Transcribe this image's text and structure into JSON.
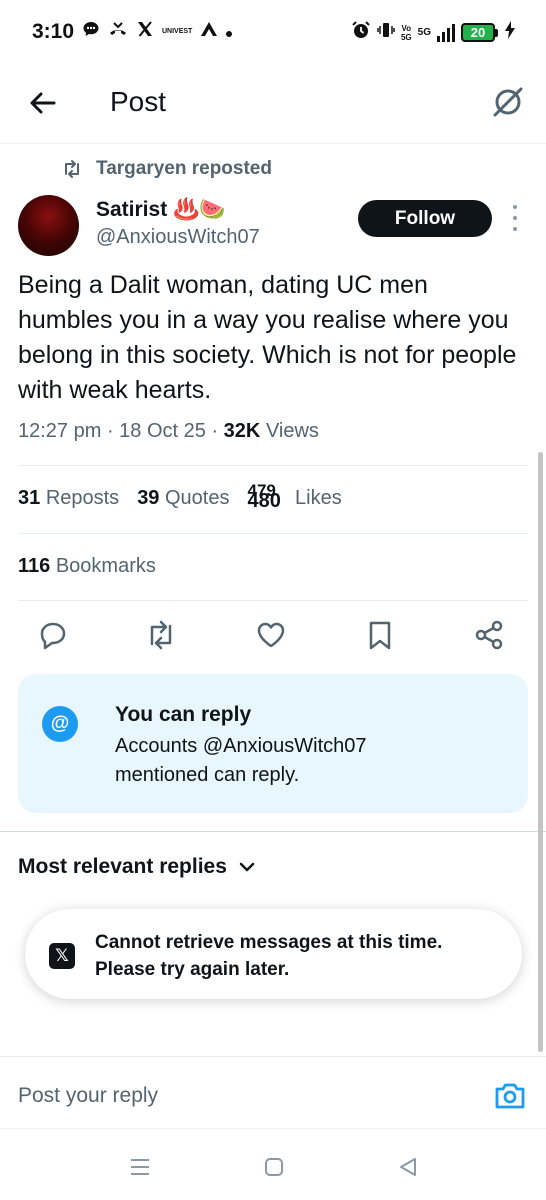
{
  "status_bar": {
    "time": "3:10",
    "left_small_label": "UNIVEST",
    "volte_line1": "Vo",
    "volte_line2": "5G",
    "network": "5G",
    "battery": "20"
  },
  "header": {
    "title": "Post"
  },
  "post": {
    "repost_label": "Targaryen reposted",
    "author_name": "Satirist",
    "author_emoji": "♨️🍉",
    "author_handle": "@AnxiousWitch07",
    "follow_label": "Follow",
    "text": "Being a Dalit woman, dating UC men humbles you in a way you realise where you belong in this society. Which is not for people with weak hearts.",
    "time": "12:27 pm",
    "date": "18 Oct 25",
    "views_count": "32K",
    "views_label": "Views",
    "reposts_count": "31",
    "reposts_label": "Reposts",
    "quotes_count": "39",
    "quotes_label": "Quotes",
    "likes_count_old": "479",
    "likes_count_new": "480",
    "likes_label": "Likes",
    "bookmarks_count": "116",
    "bookmarks_label": "Bookmarks"
  },
  "reply_restriction": {
    "badge": "@",
    "title": "You can reply",
    "description": "Accounts @AnxiousWitch07 mentioned can reply."
  },
  "replies": {
    "sort_label": "Most relevant replies"
  },
  "toast": {
    "badge": "𝕏",
    "line1": "Cannot retrieve messages at this time.",
    "line2": "Please try again later."
  },
  "compose": {
    "placeholder": "Post your reply"
  },
  "colors": {
    "accent": "#1d9bf0",
    "text_primary": "#0f1419",
    "text_secondary": "#536471",
    "card_background": "#e8f6fd",
    "battery_green": "#22b14c"
  },
  "icons": [
    "arrow-left-icon",
    "grok-icon",
    "repost-icon",
    "more-vertical-icon",
    "reply-icon",
    "retweet-icon",
    "heart-icon",
    "bookmark-icon",
    "share-icon",
    "chevron-down-icon",
    "camera-icon",
    "menu-icon",
    "home-square-icon",
    "back-triangle-icon"
  ]
}
